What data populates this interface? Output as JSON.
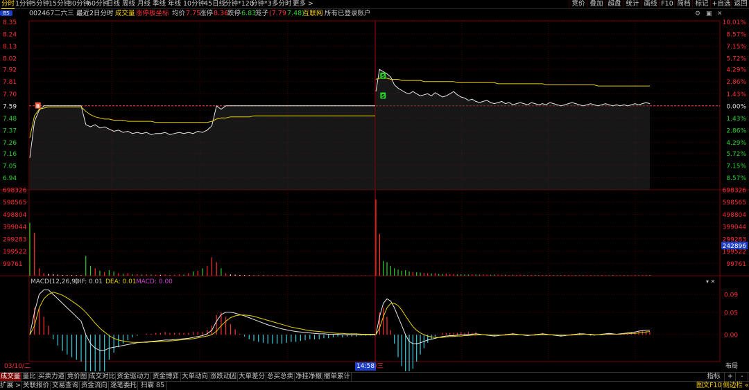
{
  "toolbar": {
    "tabs": [
      "分时",
      "1分钟",
      "5分钟",
      "15分钟",
      "30分钟",
      "60分钟",
      "日线",
      "周线",
      "月线",
      "季线",
      "年线",
      "10分钟",
      "45日线",
      "分钟*120",
      "分钟*3",
      "多分时",
      "更多 >"
    ],
    "active_tab": "分时",
    "right_buttons": [
      "竞价",
      "叠加",
      "超盘",
      "统计",
      "画线",
      "F10",
      "简档",
      "标记",
      "+自选",
      "返回"
    ]
  },
  "info": {
    "badge": "BS",
    "code": "002467",
    "name": "二六三",
    "period": "最近2日分时",
    "volume_label": "成交量",
    "limit_label": "涨停板坐标",
    "avg_label": "均价",
    "avg_value": "7.75",
    "up_limit_label": "涨停",
    "up_limit_value": "8.36",
    "down_limit_label": "跌停",
    "down_limit_value": "6.83",
    "note_label": "笼子",
    "note_value": "(7.79",
    "note_value2": "7.48)",
    "sector": "互联网",
    "account": "所有已登录账户"
  },
  "window_icons": [
    "settings-icon",
    "restore-icon",
    "close-icon"
  ],
  "chart_data": {
    "type": "line",
    "prev_close": 7.59,
    "price_axis": {
      "left_labels": [
        "8.35",
        "8.24",
        "8.13",
        "8.02",
        "7.92",
        "7.81",
        "7.70",
        "7.59",
        "7.48",
        "7.37",
        "7.26",
        "7.16",
        "7.05",
        "6.94"
      ],
      "right_labels": [
        "10.01%",
        "8.57%",
        "7.15%",
        "5.72%",
        "4.29%",
        "2.86%",
        "1.43%",
        "0.00%",
        "1.43%",
        "2.86%",
        "4.29%",
        "5.72%",
        "7.15%",
        "8.57%"
      ],
      "ylim": [
        6.83,
        8.36
      ]
    },
    "days": [
      {
        "price": [
          7.12,
          7.45,
          7.55,
          7.59,
          7.59,
          7.59,
          7.59,
          7.59,
          7.59,
          7.59,
          7.59,
          7.59,
          7.42,
          7.4,
          7.42,
          7.39,
          7.4,
          7.38,
          7.36,
          7.37,
          7.35,
          7.36,
          7.34,
          7.35,
          7.34,
          7.35,
          7.33,
          7.34,
          7.34,
          7.35,
          7.33,
          7.34,
          7.35,
          7.34,
          7.35,
          7.34,
          7.36,
          7.35,
          7.37,
          7.41,
          7.59,
          7.56,
          7.59,
          7.59,
          7.59,
          7.59,
          7.59,
          7.59,
          7.59,
          7.59,
          7.59,
          7.59,
          7.59,
          7.59,
          7.59,
          7.59,
          7.59,
          7.59,
          7.59,
          7.59,
          7.59,
          7.59,
          7.59,
          7.59,
          7.59,
          7.59,
          7.59,
          7.59,
          7.59,
          7.59,
          7.59,
          7.59,
          7.59,
          7.59,
          7.59
        ],
        "avg": [
          7.3,
          7.5,
          7.56,
          7.57,
          7.58,
          7.58,
          7.58,
          7.58,
          7.58,
          7.58,
          7.58,
          7.58,
          7.54,
          7.51,
          7.49,
          7.48,
          7.47,
          7.47,
          7.46,
          7.46,
          7.46,
          7.45,
          7.45,
          7.45,
          7.45,
          7.45,
          7.45,
          7.44,
          7.44,
          7.44,
          7.44,
          7.44,
          7.44,
          7.44,
          7.44,
          7.44,
          7.44,
          7.44,
          7.44,
          7.45,
          7.47,
          7.48,
          7.48,
          7.49,
          7.49,
          7.49,
          7.49,
          7.49,
          7.5,
          7.5,
          7.5,
          7.5,
          7.5,
          7.5,
          7.5,
          7.5,
          7.5,
          7.5,
          7.5,
          7.5,
          7.5,
          7.5,
          7.5,
          7.5,
          7.5,
          7.5,
          7.5,
          7.5,
          7.5,
          7.5,
          7.5,
          7.5,
          7.5,
          7.5,
          7.5
        ]
      },
      {
        "price": [
          7.72,
          7.92,
          7.9,
          7.88,
          7.85,
          7.78,
          7.75,
          7.73,
          7.71,
          7.7,
          7.72,
          7.7,
          7.68,
          7.69,
          7.7,
          7.68,
          7.71,
          7.69,
          7.67,
          7.68,
          7.7,
          7.72,
          7.69,
          7.67,
          7.66,
          7.64,
          7.65,
          7.63,
          7.62,
          7.63,
          7.64,
          7.62,
          7.61,
          7.62,
          7.63,
          7.61,
          7.62,
          7.6,
          7.61,
          7.62,
          7.61,
          7.6,
          7.62,
          7.61,
          7.6,
          7.61,
          7.6,
          7.62,
          7.61,
          7.6,
          7.59,
          7.6,
          7.61,
          7.62,
          7.61,
          7.6,
          7.59,
          7.6,
          7.61,
          7.6,
          7.59,
          7.6,
          7.61,
          7.6,
          7.59,
          7.6,
          7.59,
          7.6,
          7.59,
          7.6,
          7.61,
          7.6,
          7.61,
          7.62,
          7.61
        ],
        "avg": [
          7.83,
          7.84,
          7.84,
          7.84,
          7.83,
          7.83,
          7.83,
          7.82,
          7.82,
          7.82,
          7.82,
          7.82,
          7.82,
          7.81,
          7.81,
          7.81,
          7.81,
          7.81,
          7.81,
          7.81,
          7.81,
          7.81,
          7.8,
          7.8,
          7.8,
          7.8,
          7.8,
          7.8,
          7.8,
          7.8,
          7.8,
          7.8,
          7.8,
          7.79,
          7.79,
          7.79,
          7.79,
          7.79,
          7.79,
          7.79,
          7.79,
          7.79,
          7.79,
          7.79,
          7.79,
          7.79,
          7.78,
          7.78,
          7.78,
          7.78,
          7.78,
          7.78,
          7.78,
          7.78,
          7.78,
          7.78,
          7.78,
          7.78,
          7.78,
          7.78,
          7.77,
          7.77,
          7.77,
          7.77,
          7.77,
          7.77,
          7.77,
          7.77,
          7.77,
          7.77,
          7.77,
          7.77,
          7.77,
          7.77,
          7.77
        ]
      }
    ],
    "trade_marks": [
      {
        "label": "B",
        "day": 0,
        "index": 1,
        "price": 7.59
      },
      {
        "label": "S",
        "day": 1,
        "index": 1,
        "price": 7.86
      },
      {
        "label": "S",
        "day": 1,
        "index": 1,
        "price": 7.68
      }
    ],
    "volume_axis": {
      "labels": [
        "698326",
        "598565",
        "498804",
        "399044",
        "299283",
        "199522",
        "99761"
      ],
      "current": "242896",
      "ymax": 698326
    },
    "volumes": [
      [
        430000,
        350000,
        60000,
        20000,
        15000,
        12000,
        8000,
        6000,
        5000,
        5000,
        4000,
        4000,
        160000,
        80000,
        60000,
        40000,
        30000,
        45000,
        35000,
        20000,
        15000,
        20000,
        10000,
        12000,
        8000,
        10000,
        9000,
        8000,
        7000,
        9000,
        6000,
        7000,
        10000,
        8000,
        20000,
        35000,
        40000,
        60000,
        80000,
        150000,
        110000,
        60000,
        20000,
        10000,
        8000,
        6000,
        5000,
        4000,
        3000,
        3000,
        3000,
        2000,
        2000,
        2000,
        2000,
        2000,
        2000,
        2000,
        1000,
        1000,
        1000,
        1000,
        1000,
        1000,
        1000,
        1000,
        1000,
        1000,
        1000,
        1000,
        1000,
        1000,
        1000,
        1000,
        1000
      ],
      [
        620000,
        340000,
        120000,
        110000,
        80000,
        60000,
        50000,
        40000,
        45000,
        35000,
        30000,
        28000,
        25000,
        22000,
        20000,
        18000,
        20000,
        15000,
        14000,
        16000,
        12000,
        14000,
        10000,
        12000,
        10000,
        9000,
        11000,
        9000,
        8000,
        10000,
        8000,
        7000,
        9000,
        8000,
        7000,
        8000,
        6000,
        7000,
        6000,
        8000,
        6000,
        5000,
        7000,
        6000,
        5000,
        6000,
        5000,
        6000,
        5000,
        4000,
        5000,
        6000,
        5000,
        4000,
        5000,
        4000,
        5000,
        4000,
        5000,
        4000,
        4000,
        5000,
        4000,
        4000,
        5000,
        4000,
        4000,
        5000,
        4000,
        4000,
        5000,
        4000,
        5000,
        6000,
        5000
      ]
    ],
    "volume_colors": {
      "up": "#ff3030",
      "down": "#2ad32a",
      "flat": "#ffffff"
    },
    "macd": {
      "label": "MACD(12,26,9)",
      "dif_label": "DIF: 0.01",
      "dea_label": "DEA: 0.01",
      "macd_label": "MACD: 0.00",
      "axis_labels": [
        "0.09",
        "0.05",
        "0.00"
      ],
      "ylim": [
        -0.06,
        0.11
      ],
      "days": [
        {
          "dif": [
            0.0,
            0.05,
            0.09,
            0.1,
            0.1,
            0.09,
            0.08,
            0.07,
            0.06,
            0.05,
            0.04,
            0.03,
            0.0,
            -0.02,
            -0.03,
            -0.035,
            -0.035,
            -0.03,
            -0.028,
            -0.026,
            -0.024,
            -0.022,
            -0.02,
            -0.018,
            -0.017,
            -0.016,
            -0.015,
            -0.014,
            -0.013,
            -0.012,
            -0.012,
            -0.011,
            -0.01,
            -0.009,
            -0.008,
            -0.006,
            -0.004,
            -0.002,
            0.002,
            0.01,
            0.03,
            0.045,
            0.05,
            0.05,
            0.048,
            0.045,
            0.042,
            0.038,
            0.034,
            0.03,
            0.026,
            0.022,
            0.019,
            0.016,
            0.013,
            0.011,
            0.009,
            0.007,
            0.006,
            0.005,
            0.004,
            0.003,
            0.002,
            0.002,
            0.001,
            0.001,
            0.001,
            0.0,
            0.0,
            0.0,
            0.0,
            0.0,
            0.0,
            0.0,
            0.0
          ],
          "dea": [
            0.0,
            0.02,
            0.06,
            0.08,
            0.09,
            0.095,
            0.092,
            0.088,
            0.082,
            0.075,
            0.068,
            0.06,
            0.05,
            0.038,
            0.026,
            0.015,
            0.006,
            -0.002,
            -0.008,
            -0.012,
            -0.014,
            -0.016,
            -0.017,
            -0.017,
            -0.017,
            -0.017,
            -0.016,
            -0.016,
            -0.015,
            -0.015,
            -0.014,
            -0.013,
            -0.012,
            -0.011,
            -0.01,
            -0.009,
            -0.007,
            -0.005,
            -0.003,
            0.0,
            0.008,
            0.02,
            0.03,
            0.038,
            0.042,
            0.044,
            0.044,
            0.043,
            0.041,
            0.038,
            0.035,
            0.032,
            0.029,
            0.026,
            0.023,
            0.02,
            0.017,
            0.015,
            0.013,
            0.011,
            0.009,
            0.008,
            0.007,
            0.006,
            0.005,
            0.004,
            0.003,
            0.003,
            0.002,
            0.002,
            0.002,
            0.001,
            0.001,
            0.001,
            0.001
          ]
        },
        {
          "dif": [
            0.0,
            0.04,
            0.07,
            0.08,
            0.075,
            0.06,
            0.04,
            0.02,
            0.0,
            -0.015,
            -0.02,
            -0.02,
            -0.018,
            -0.015,
            -0.012,
            -0.01,
            -0.008,
            -0.006,
            -0.004,
            -0.003,
            -0.002,
            -0.002,
            -0.001,
            0.0,
            0.0,
            0.001,
            0.001,
            0.002,
            0.001,
            0.0,
            -0.001,
            -0.002,
            -0.003,
            -0.002,
            -0.001,
            0.0,
            0.001,
            0.002,
            0.001,
            0.0,
            -0.001,
            -0.002,
            -0.001,
            0.0,
            0.001,
            0.002,
            0.001,
            0.0,
            -0.001,
            -0.002,
            -0.003,
            -0.002,
            -0.001,
            0.0,
            0.001,
            0.002,
            0.002,
            0.001,
            0.0,
            -0.001,
            0.0,
            0.001,
            0.002,
            0.003,
            0.002,
            0.001,
            0.002,
            0.003,
            0.004,
            0.005,
            0.006,
            0.008,
            0.009,
            0.01,
            0.01
          ],
          "dea": [
            0.0,
            0.015,
            0.04,
            0.06,
            0.07,
            0.07,
            0.065,
            0.055,
            0.042,
            0.03,
            0.018,
            0.01,
            0.004,
            0.0,
            -0.003,
            -0.005,
            -0.006,
            -0.006,
            -0.006,
            -0.005,
            -0.004,
            -0.004,
            -0.003,
            -0.003,
            -0.002,
            -0.002,
            -0.001,
            -0.001,
            0.0,
            0.0,
            0.0,
            -0.001,
            -0.001,
            -0.001,
            -0.001,
            -0.001,
            0.0,
            0.0,
            0.0,
            0.0,
            0.0,
            -0.001,
            -0.001,
            -0.001,
            0.0,
            0.0,
            0.0,
            0.0,
            0.0,
            -0.001,
            -0.001,
            -0.001,
            -0.001,
            -0.001,
            0.0,
            0.0,
            0.001,
            0.001,
            0.001,
            0.0,
            0.0,
            0.0,
            0.001,
            0.001,
            0.001,
            0.001,
            0.001,
            0.002,
            0.002,
            0.003,
            0.003,
            0.004,
            0.005,
            0.006,
            0.007
          ]
        }
      ]
    },
    "x_labels": {
      "day1": "03/10/二",
      "crosshair": "14:58",
      "day2": "/三"
    }
  },
  "bottom_tabs_1": [
    "成交量",
    "量比",
    "买卖力道",
    "竞价图",
    "成交对比",
    "资金驱动力",
    "资金博弈",
    "大单动向",
    "涨跌动因",
    "大单差分",
    "总买总卖",
    "净挂净撤",
    "撤单累计"
  ],
  "bottom_tabs_1_active": "成交量",
  "bottom_right_1": [
    "指标",
    "+",
    "-"
  ],
  "bottom_tabs_2": [
    "扩展 >",
    "关联报价",
    "交易查询",
    "资金流向",
    "逐笔委托",
    "扫霸 85"
  ],
  "bottom_right_2": {
    "f10": "图文F10",
    "side": "侧边栏 «"
  },
  "layout_label": "布局"
}
